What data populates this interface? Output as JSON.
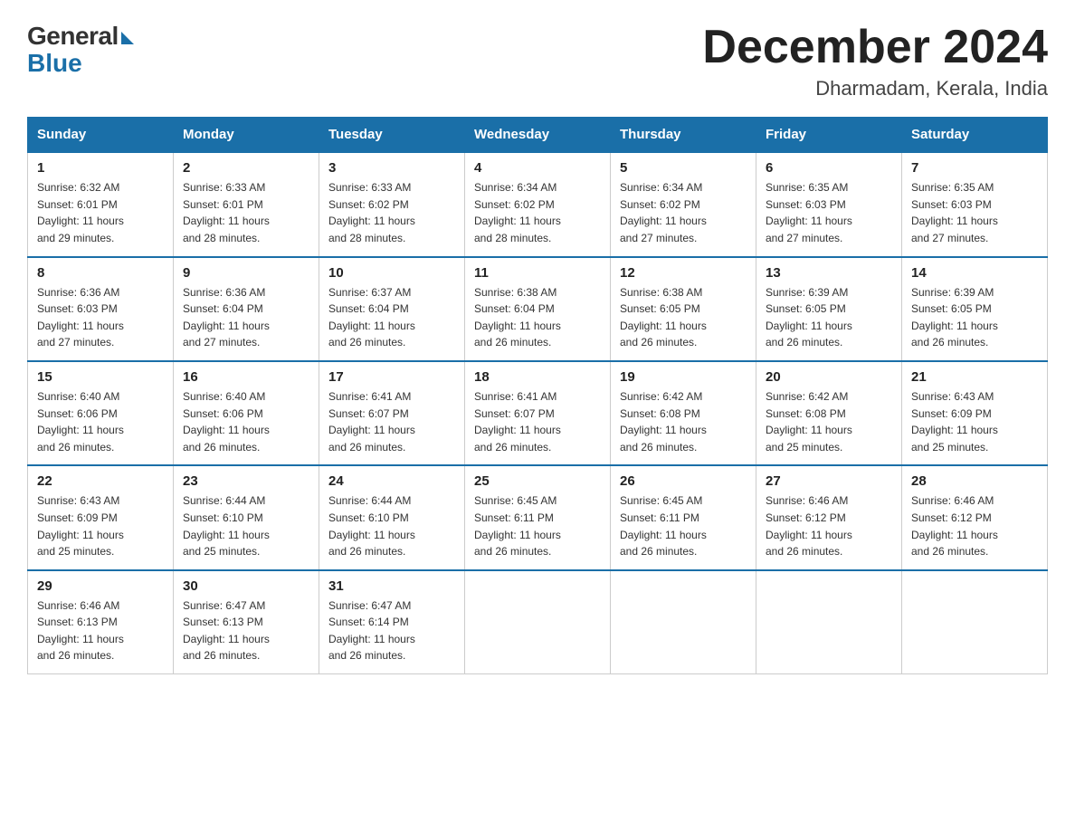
{
  "logo": {
    "general": "General",
    "blue": "Blue"
  },
  "header": {
    "month_year": "December 2024",
    "location": "Dharmadam, Kerala, India"
  },
  "days_of_week": [
    "Sunday",
    "Monday",
    "Tuesday",
    "Wednesday",
    "Thursday",
    "Friday",
    "Saturday"
  ],
  "weeks": [
    [
      {
        "day": "1",
        "sunrise": "6:32 AM",
        "sunset": "6:01 PM",
        "daylight": "11 hours and 29 minutes."
      },
      {
        "day": "2",
        "sunrise": "6:33 AM",
        "sunset": "6:01 PM",
        "daylight": "11 hours and 28 minutes."
      },
      {
        "day": "3",
        "sunrise": "6:33 AM",
        "sunset": "6:02 PM",
        "daylight": "11 hours and 28 minutes."
      },
      {
        "day": "4",
        "sunrise": "6:34 AM",
        "sunset": "6:02 PM",
        "daylight": "11 hours and 28 minutes."
      },
      {
        "day": "5",
        "sunrise": "6:34 AM",
        "sunset": "6:02 PM",
        "daylight": "11 hours and 27 minutes."
      },
      {
        "day": "6",
        "sunrise": "6:35 AM",
        "sunset": "6:03 PM",
        "daylight": "11 hours and 27 minutes."
      },
      {
        "day": "7",
        "sunrise": "6:35 AM",
        "sunset": "6:03 PM",
        "daylight": "11 hours and 27 minutes."
      }
    ],
    [
      {
        "day": "8",
        "sunrise": "6:36 AM",
        "sunset": "6:03 PM",
        "daylight": "11 hours and 27 minutes."
      },
      {
        "day": "9",
        "sunrise": "6:36 AM",
        "sunset": "6:04 PM",
        "daylight": "11 hours and 27 minutes."
      },
      {
        "day": "10",
        "sunrise": "6:37 AM",
        "sunset": "6:04 PM",
        "daylight": "11 hours and 26 minutes."
      },
      {
        "day": "11",
        "sunrise": "6:38 AM",
        "sunset": "6:04 PM",
        "daylight": "11 hours and 26 minutes."
      },
      {
        "day": "12",
        "sunrise": "6:38 AM",
        "sunset": "6:05 PM",
        "daylight": "11 hours and 26 minutes."
      },
      {
        "day": "13",
        "sunrise": "6:39 AM",
        "sunset": "6:05 PM",
        "daylight": "11 hours and 26 minutes."
      },
      {
        "day": "14",
        "sunrise": "6:39 AM",
        "sunset": "6:05 PM",
        "daylight": "11 hours and 26 minutes."
      }
    ],
    [
      {
        "day": "15",
        "sunrise": "6:40 AM",
        "sunset": "6:06 PM",
        "daylight": "11 hours and 26 minutes."
      },
      {
        "day": "16",
        "sunrise": "6:40 AM",
        "sunset": "6:06 PM",
        "daylight": "11 hours and 26 minutes."
      },
      {
        "day": "17",
        "sunrise": "6:41 AM",
        "sunset": "6:07 PM",
        "daylight": "11 hours and 26 minutes."
      },
      {
        "day": "18",
        "sunrise": "6:41 AM",
        "sunset": "6:07 PM",
        "daylight": "11 hours and 26 minutes."
      },
      {
        "day": "19",
        "sunrise": "6:42 AM",
        "sunset": "6:08 PM",
        "daylight": "11 hours and 26 minutes."
      },
      {
        "day": "20",
        "sunrise": "6:42 AM",
        "sunset": "6:08 PM",
        "daylight": "11 hours and 25 minutes."
      },
      {
        "day": "21",
        "sunrise": "6:43 AM",
        "sunset": "6:09 PM",
        "daylight": "11 hours and 25 minutes."
      }
    ],
    [
      {
        "day": "22",
        "sunrise": "6:43 AM",
        "sunset": "6:09 PM",
        "daylight": "11 hours and 25 minutes."
      },
      {
        "day": "23",
        "sunrise": "6:44 AM",
        "sunset": "6:10 PM",
        "daylight": "11 hours and 25 minutes."
      },
      {
        "day": "24",
        "sunrise": "6:44 AM",
        "sunset": "6:10 PM",
        "daylight": "11 hours and 26 minutes."
      },
      {
        "day": "25",
        "sunrise": "6:45 AM",
        "sunset": "6:11 PM",
        "daylight": "11 hours and 26 minutes."
      },
      {
        "day": "26",
        "sunrise": "6:45 AM",
        "sunset": "6:11 PM",
        "daylight": "11 hours and 26 minutes."
      },
      {
        "day": "27",
        "sunrise": "6:46 AM",
        "sunset": "6:12 PM",
        "daylight": "11 hours and 26 minutes."
      },
      {
        "day": "28",
        "sunrise": "6:46 AM",
        "sunset": "6:12 PM",
        "daylight": "11 hours and 26 minutes."
      }
    ],
    [
      {
        "day": "29",
        "sunrise": "6:46 AM",
        "sunset": "6:13 PM",
        "daylight": "11 hours and 26 minutes."
      },
      {
        "day": "30",
        "sunrise": "6:47 AM",
        "sunset": "6:13 PM",
        "daylight": "11 hours and 26 minutes."
      },
      {
        "day": "31",
        "sunrise": "6:47 AM",
        "sunset": "6:14 PM",
        "daylight": "11 hours and 26 minutes."
      },
      null,
      null,
      null,
      null
    ]
  ],
  "labels": {
    "sunrise": "Sunrise:",
    "sunset": "Sunset:",
    "daylight": "Daylight:"
  }
}
